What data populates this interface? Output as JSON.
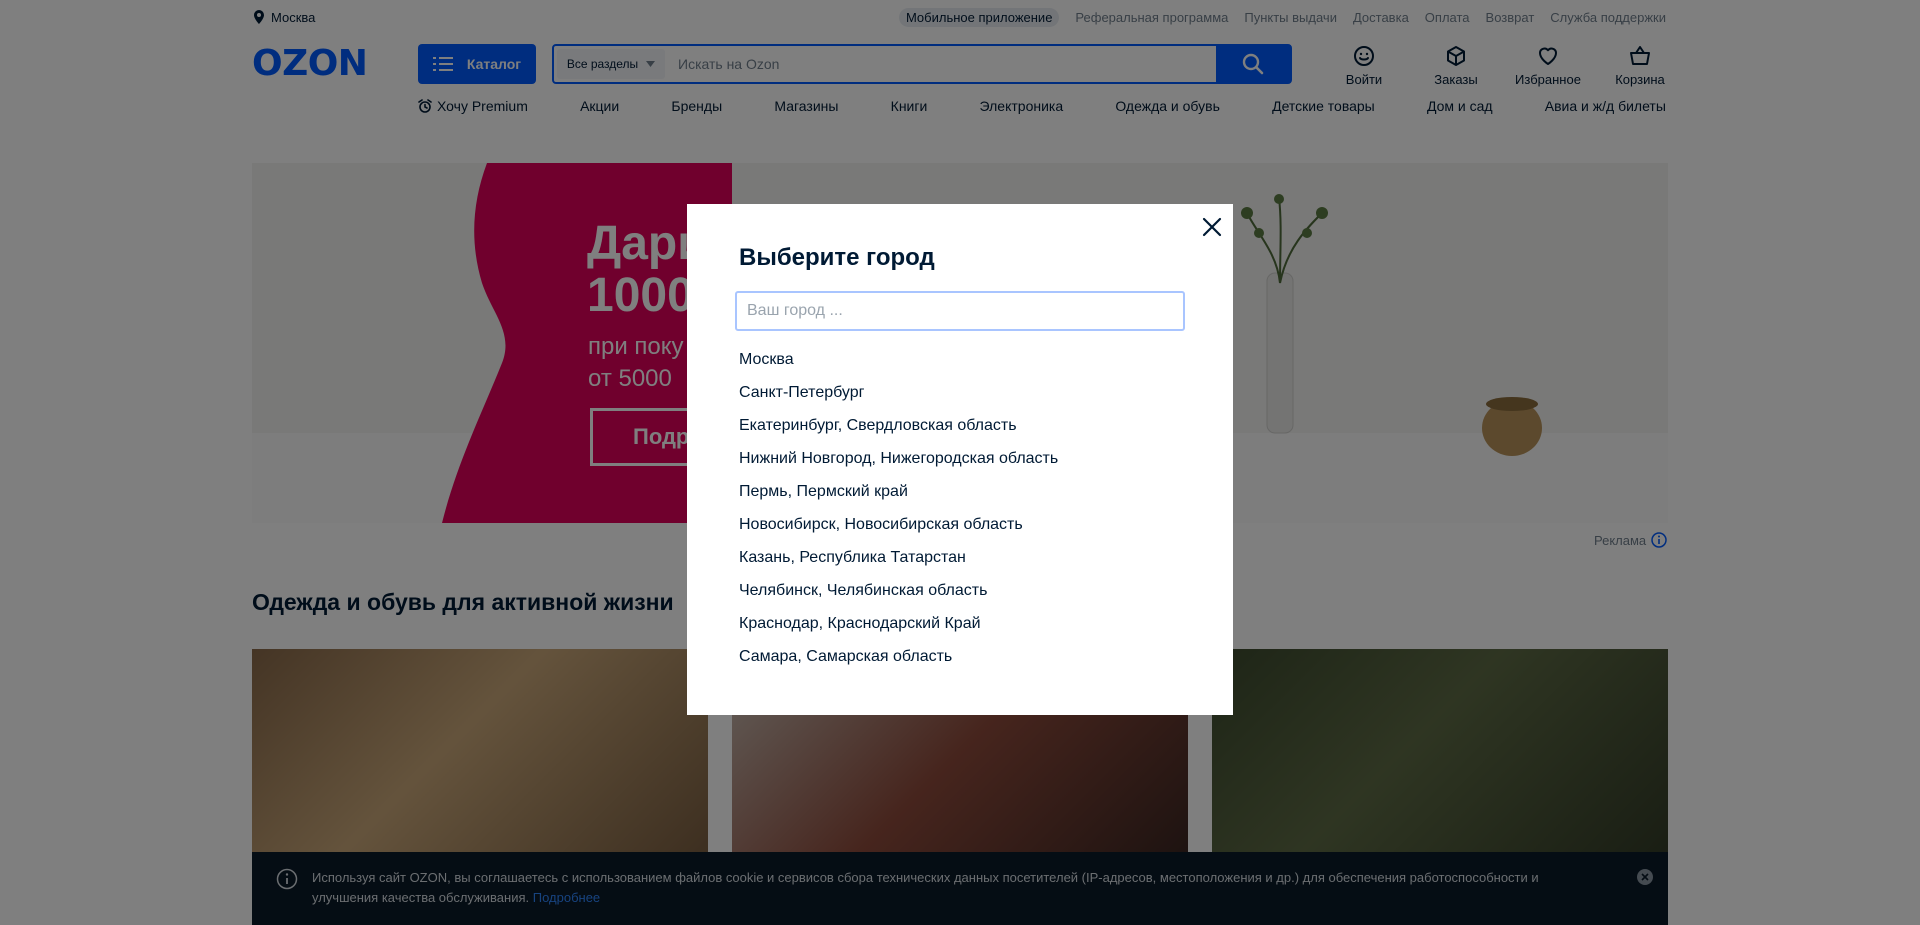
{
  "topbar": {
    "city": "Москва",
    "links": [
      "Мобильное приложение",
      "Реферальная программа",
      "Пункты выдачи",
      "Доставка",
      "Оплата",
      "Возврат",
      "Служба поддержки"
    ]
  },
  "header": {
    "logo": "OZON",
    "catalog_label": "Каталог",
    "search_scope": "Все разделы",
    "search_placeholder": "Искать на Ozon",
    "user_nav": [
      "Войти",
      "Заказы",
      "Избранное",
      "Корзина"
    ]
  },
  "category_nav": [
    "Хочу Premium",
    "Акции",
    "Бренды",
    "Магазины",
    "Книги",
    "Электроника",
    "Одежда и обувь",
    "Детские товары",
    "Дом и сад",
    "Авиа и ж/д билеты"
  ],
  "banner": {
    "headline_line1": "Дари",
    "headline_line2": "1000",
    "sub_line1": "при поку",
    "sub_line2": "от 5000",
    "cta": "Подр",
    "ad_label": "Реклама"
  },
  "section": {
    "title": "Одежда и обувь для активной жизни"
  },
  "modal": {
    "title": "Выберите город",
    "input_placeholder": "Ваш город ...",
    "cities": [
      "Москва",
      "Санкт-Петербург",
      "Екатеринбург, Свердловская область",
      "Нижний Новгород, Нижегородская область",
      "Пермь, Пермский край",
      "Новосибирск, Новосибирская область",
      "Казань, Республика Татарстан",
      "Челябинск, Челябинская область",
      "Краснодар, Краснодарский Край",
      "Самара, Самарская область"
    ]
  },
  "cookie": {
    "text": "Используя сайт OZON, вы соглашаетесь с использованием файлов cookie и сервисов сбора технических данных посетителей (IP-адресов, местоположения и др.) для обеспечения работоспособности и улучшения качества обслуживания.",
    "link": "Подробнее"
  },
  "colors": {
    "brand": "#005bff",
    "banner_pink": "#e1005a",
    "text": "#001a34"
  }
}
